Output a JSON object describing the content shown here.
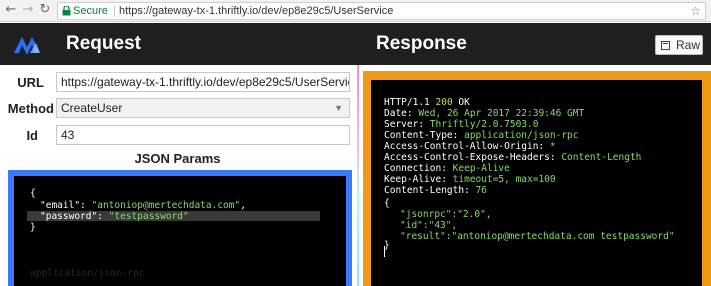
{
  "browser": {
    "secure_label": "Secure",
    "url": "https://gateway-tx-1.thriftly.io/dev/ep8e29c5/UserService"
  },
  "header": {
    "request_title": "Request",
    "response_title": "Response",
    "raw_label": "Raw"
  },
  "form": {
    "url_label": "URL",
    "url_value": "https://gateway-tx-1.thriftly.io/dev/ep8e29c5/UserService",
    "method_label": "Method",
    "method_value": "CreateUser",
    "id_label": "Id",
    "id_value": "43",
    "json_params_title": "JSON Params"
  },
  "request_json": {
    "open": "{",
    "email_key": "\"email\"",
    "email_value": "\"antoniop@mertechdata.com\"",
    "password_key": "\"password\"",
    "password_value": "\"testpassword\"",
    "close": "}",
    "ghost_text": "application/json-rpc"
  },
  "response": {
    "status_proto": "HTTP/1.1",
    "status_code": "200",
    "status_text": "OK",
    "headers": [
      {
        "key": "Date:",
        "value": "Wed, 26 Apr 2017 22:39:46 GMT"
      },
      {
        "key": "Server:",
        "value": "Thriftly/2.0.7503.0"
      },
      {
        "key": "Content-Type:",
        "value": "application/json-rpc"
      },
      {
        "key": "Access-Control-Allow-Origin:",
        "value": "*"
      },
      {
        "key": "Access-Control-Expose-Headers:",
        "value": "Content-Length"
      },
      {
        "key": "Connection:",
        "value": "Keep-Alive"
      },
      {
        "key": "Keep-Alive:",
        "value": "timeout=5, max=100"
      },
      {
        "key": "Content-Length:",
        "value": "76"
      }
    ],
    "body": {
      "open": "{",
      "jsonrpc_key": "\"jsonrpc\":",
      "jsonrpc_value": "\"2.0\",",
      "id_key": "\"id\":",
      "id_value": "\"43\",",
      "result_key": "\"result\":",
      "result_value": "\"antoniop@mertechdata.com testpassword\"",
      "close": "}"
    }
  },
  "colors": {
    "request_frame": "#3a78ff",
    "response_frame": "#ee9a14",
    "secure_green": "#0b8043"
  },
  "icons": [
    "back-arrow-icon",
    "forward-arrow-icon",
    "reload-icon",
    "lock-icon",
    "star-icon",
    "app-logo-icon",
    "raw-icon",
    "dropdown-chevron-icon"
  ]
}
